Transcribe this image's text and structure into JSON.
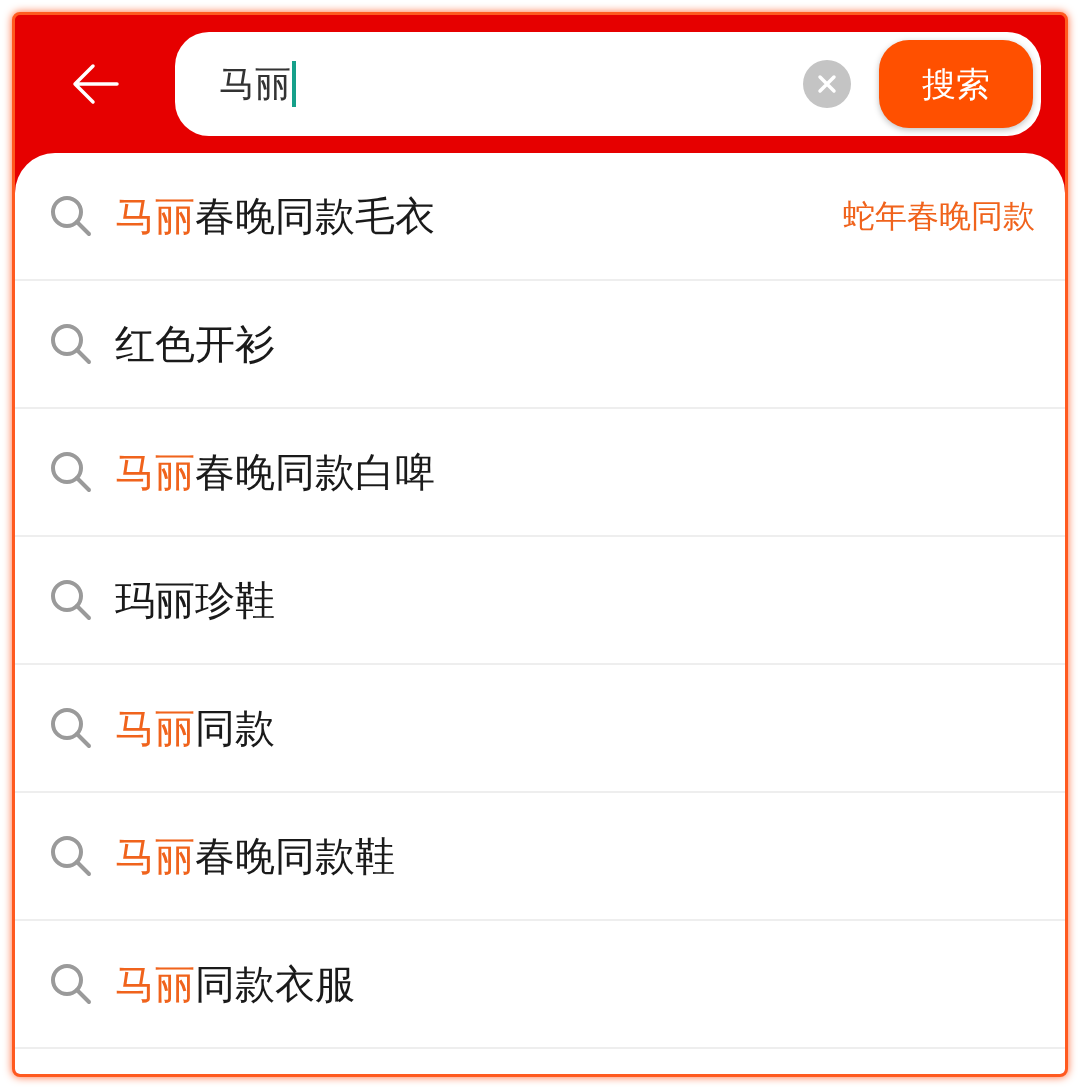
{
  "search": {
    "value": "马丽",
    "button": "搜索"
  },
  "suggestions": [
    {
      "match": "马丽",
      "rest": "春晚同款毛衣",
      "tag": "蛇年春晚同款"
    },
    {
      "rest": "红色开衫"
    },
    {
      "match": "马丽",
      "rest": "春晚同款白啤"
    },
    {
      "rest": "玛丽珍鞋"
    },
    {
      "match": "马丽",
      "rest": "同款"
    },
    {
      "match": "马丽",
      "rest": "春晚同款鞋"
    },
    {
      "match": "马丽",
      "rest": "同款衣服"
    }
  ]
}
